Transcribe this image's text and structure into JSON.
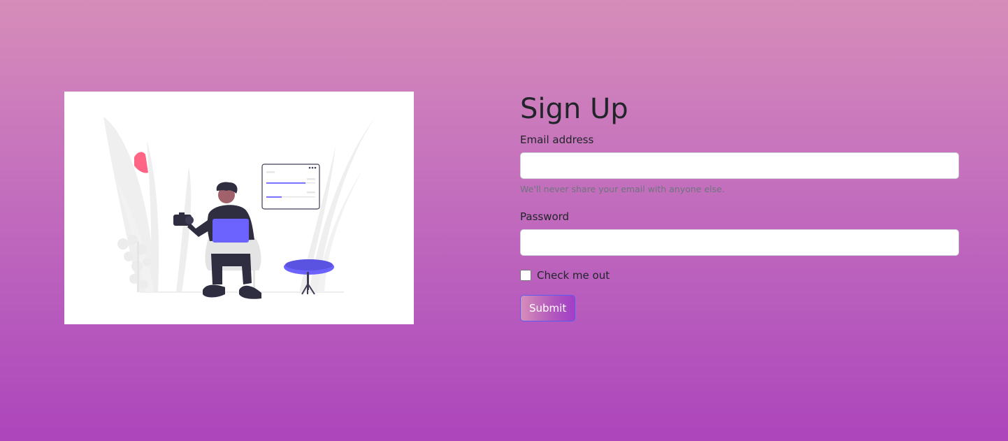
{
  "illustration": {
    "alt": "person with laptop and camera illustration",
    "accent": "#6c63ff",
    "neutral": "#f0f0f0",
    "dark": "#2f2e41"
  },
  "form": {
    "title": "Sign Up",
    "email": {
      "label": "Email address",
      "value": "",
      "placeholder": "",
      "help": "We'll never share your email with anyone else."
    },
    "password": {
      "label": "Password",
      "value": "",
      "placeholder": ""
    },
    "checkbox": {
      "label": "Check me out",
      "checked": false
    },
    "submit_label": "Submit"
  },
  "colors": {
    "background_top": "#d68db9",
    "background_bottom": "#ad45bb",
    "button_border": "#5b5cf2",
    "title_text": "#212529",
    "help_text": "#6c757d"
  }
}
